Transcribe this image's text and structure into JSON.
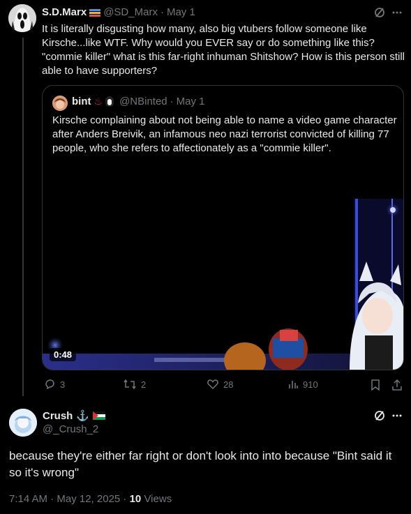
{
  "post1": {
    "name": "S.D.Marx",
    "handle": "@SD_Marx",
    "date": "May 1",
    "text": "It is literally disgusting how many, also big vtubers follow someone like Kirsche...like WTF. Why would you EVER say or do something like this? \"commie killer\" what is this far-right inhuman Shitshow? How is this person still able to have supporters?",
    "quote": {
      "name": "bint",
      "handle": "@NBinted",
      "date": "May 1",
      "text": "Kirsche complaining about not being able to name a video game character after Anders Breivik, an infamous neo nazi terrorist convicted of killing 77 people, who she refers to affectionately as a \"commie killer\".",
      "video_time": "0:48"
    },
    "actions": {
      "replies": "3",
      "reposts": "2",
      "likes": "28",
      "views": "910"
    }
  },
  "post2": {
    "name": "Crush",
    "handle": "@_Crush_2",
    "text": "because they're either far right or don't look into into because \"Bint said it so it's wrong\"",
    "time": "7:14 AM · May 12, 2025 · ",
    "views_count": "10",
    "views_label": " Views"
  },
  "colors": {
    "background": "#000000",
    "text": "#e7e9ea",
    "muted": "#71767b",
    "border": "#2f3336"
  }
}
